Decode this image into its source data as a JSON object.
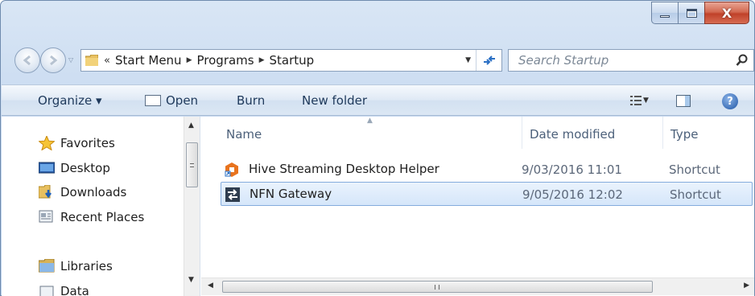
{
  "window": {
    "close_glyph": "X"
  },
  "navigation": {
    "breadcrumb_overflow": "«",
    "breadcrumbs": [
      "Start Menu",
      "Programs",
      "Startup"
    ],
    "search_placeholder": "Search Startup"
  },
  "toolbar": {
    "organize": "Organize ▾",
    "open": "Open",
    "burn": "Burn",
    "new_folder": "New folder",
    "help_glyph": "?"
  },
  "nav_pane": {
    "favorites": "Favorites",
    "items": [
      "Desktop",
      "Downloads",
      "Recent Places"
    ],
    "libraries": "Libraries",
    "libraries_items": [
      "Data"
    ]
  },
  "file_list": {
    "columns": {
      "name": "Name",
      "date_modified": "Date modified",
      "type": "Type"
    },
    "rows": [
      {
        "name": "Hive Streaming Desktop Helper",
        "date": "9/03/2016 11:01",
        "type": "Shortcut",
        "selected": false,
        "icon": "hive-shortcut-icon"
      },
      {
        "name": "NFN Gateway",
        "date": "9/05/2016 12:02",
        "type": "Shortcut",
        "selected": true,
        "icon": "nfn-shortcut-icon"
      }
    ]
  },
  "colors": {
    "selection_fill": "#d5e6fa",
    "selection_border": "#84acdd",
    "toolbar_text": "#1e395b"
  }
}
